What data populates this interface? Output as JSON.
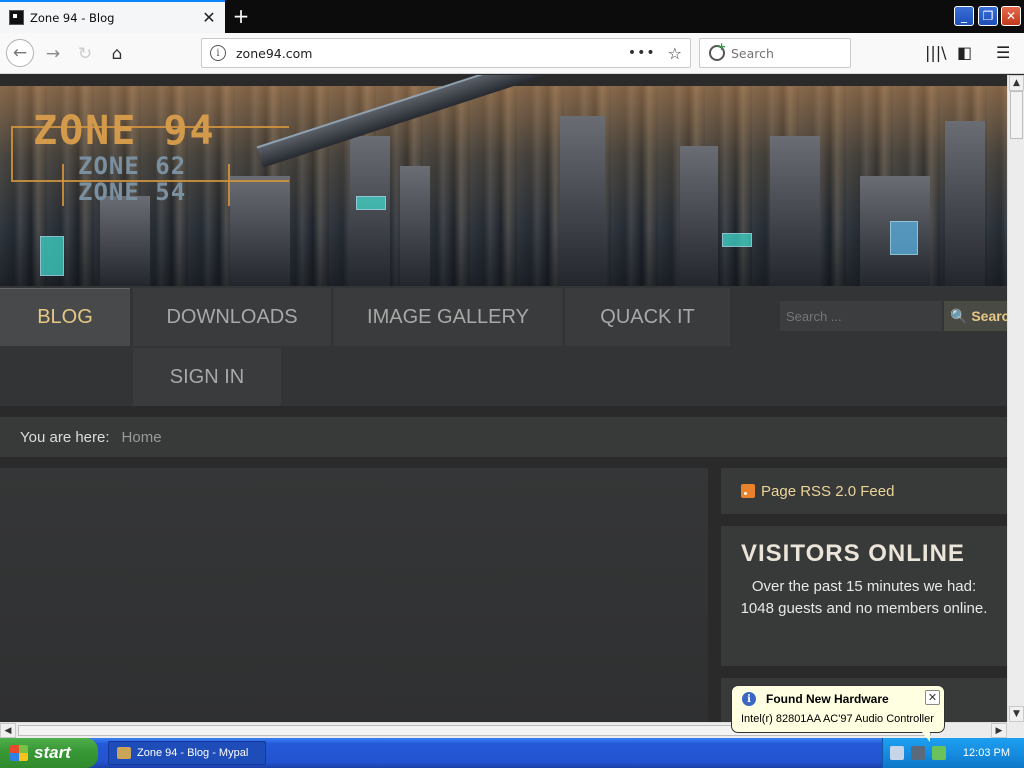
{
  "browser": {
    "tab_title": "Zone 94 - Blog",
    "tab_close_glyph": "✕",
    "newtab_glyph": "+",
    "url": "zone94.com",
    "url_info_glyph": "i",
    "url_more_glyph": "•••",
    "bookmark_glyph": "☆",
    "search_placeholder": "Search",
    "back_glyph": "←",
    "forward_glyph": "→",
    "reload_glyph": "↻",
    "home_glyph": "⌂",
    "library_glyph": "|||\\",
    "sidebar_glyph": "◧",
    "menu_glyph": "☰",
    "win_min": "_",
    "win_max": "❐",
    "win_close": "✕"
  },
  "site": {
    "logo_title": "ZONE 94",
    "logo_sub1": "ZONE 62",
    "logo_sub2": "ZONE 54",
    "menu": {
      "blog": "BLOG",
      "downloads": "DOWNLOADS",
      "gallery": "IMAGE GALLERY",
      "quack": "QUACK IT",
      "signin": "SIGN IN"
    },
    "search_placeholder": "Search ...",
    "search_button": "🔍 Search",
    "breadcrumb_label": "You are here:",
    "breadcrumb_home": "Home",
    "rss_link": "Page RSS 2.0 Feed",
    "visitors_title": "VISITORS ONLINE",
    "visitors_text": "Over the past 15 minutes we had: 1048 guests and no members online."
  },
  "scroll": {
    "up": "▲",
    "down": "▼",
    "left": "◀",
    "right": "▶"
  },
  "taskbar": {
    "start_label": "start",
    "task_label": "Zone 94 - Blog - Mypal",
    "clock": "12:03 PM"
  },
  "balloon": {
    "title": "Found New Hardware",
    "body": "Intel(r) 82801AA AC'97 Audio Controller",
    "close_glyph": "✕",
    "info_glyph": "i"
  },
  "colors": {
    "menu_active_text": "#e6c885",
    "rss_link": "#ead49a",
    "taskbar": "#2459d8",
    "start_button": "#3a9a37",
    "balloon_bg": "#ffffe1"
  }
}
